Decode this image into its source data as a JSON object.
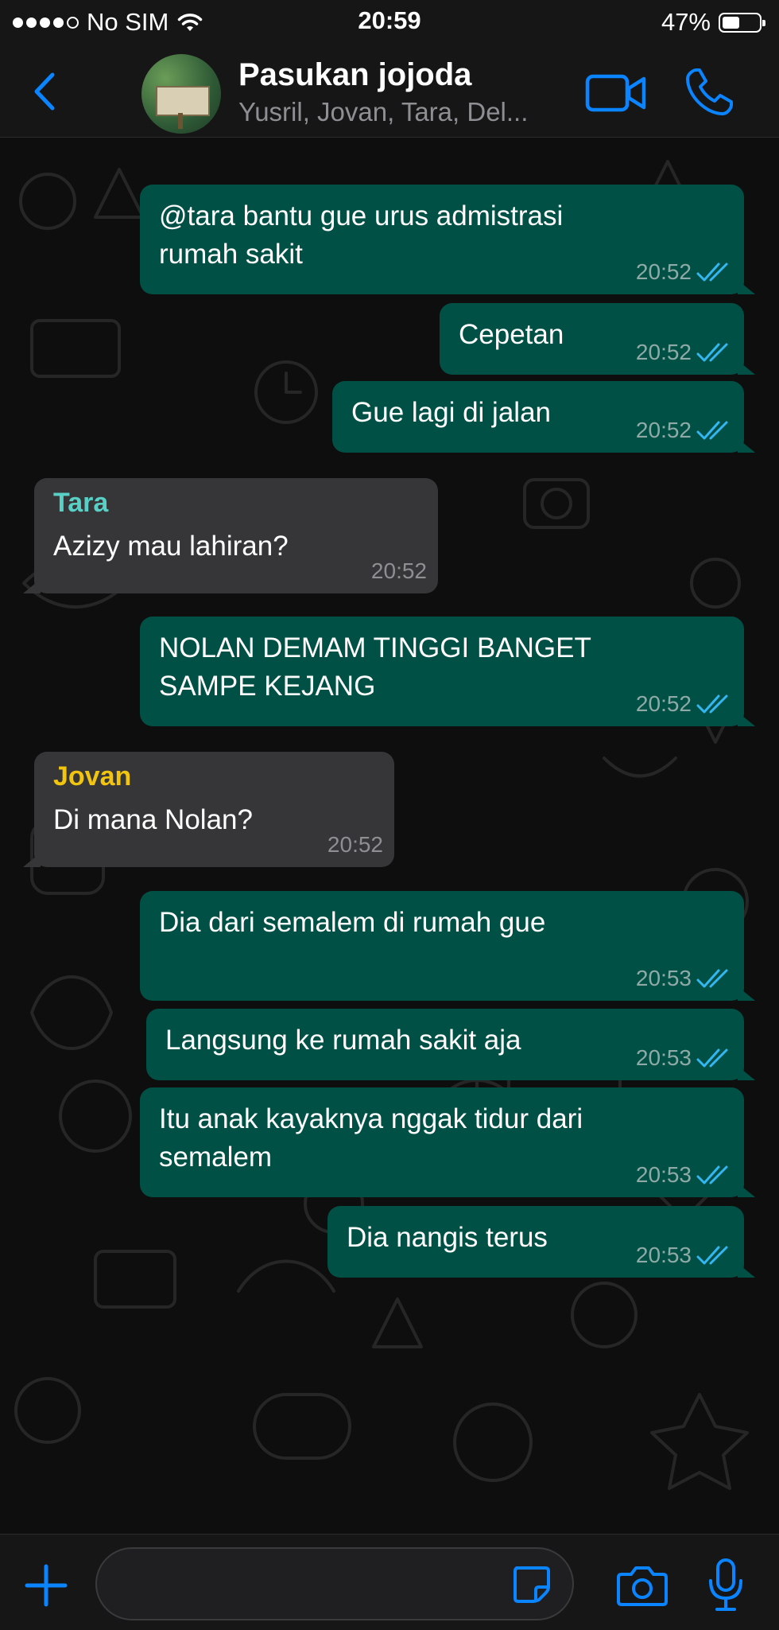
{
  "status_bar": {
    "carrier": "No SIM",
    "time": "20:59",
    "battery": "47%",
    "battery_level": 0.47,
    "signal_dots": 5,
    "signal_filled": 4
  },
  "header": {
    "back_icon": "chevron-left-icon",
    "title": "Pasukan jojoda",
    "subtitle": "Yusril, Jovan, Tara, Del...",
    "video_icon": "video-camera-icon",
    "call_icon": "phone-icon"
  },
  "colors": {
    "accent": "#0a84ff",
    "outgoing_bubble": "#005046",
    "incoming_bubble": "#363638",
    "read_ticks": "#34b7f1",
    "sender_tara": "#58d0c6",
    "sender_jovan": "#f1c40f"
  },
  "messages": [
    {
      "dir": "out",
      "lines": [
        "@tara bantu gue urus admistrasi",
        "rumah sakit"
      ],
      "time": "20:52",
      "read": true
    },
    {
      "dir": "out",
      "lines": [
        "Cepetan"
      ],
      "time": "20:52",
      "read": true
    },
    {
      "dir": "out",
      "lines": [
        "Gue lagi di jalan"
      ],
      "time": "20:52",
      "read": true
    },
    {
      "dir": "in",
      "sender": "Tara",
      "lines": [
        "Azizy mau lahiran?"
      ],
      "time": "20:52"
    },
    {
      "dir": "out",
      "lines": [
        "NOLAN DEMAM TINGGI BANGET",
        "SAMPE KEJANG"
      ],
      "time": "20:52",
      "read": true
    },
    {
      "dir": "in",
      "sender": "Jovan",
      "lines": [
        "Di mana Nolan?"
      ],
      "time": "20:52"
    },
    {
      "dir": "out",
      "lines": [
        "Dia dari semalem di rumah gue"
      ],
      "time": "20:53",
      "read": true
    },
    {
      "dir": "out",
      "lines": [
        "Langsung ke rumah sakit aja"
      ],
      "time": "20:53",
      "read": true
    },
    {
      "dir": "out",
      "lines": [
        "Itu anak kayaknya nggak tidur dari",
        "semalem"
      ],
      "time": "20:53",
      "read": true
    },
    {
      "dir": "out",
      "lines": [
        "Dia nangis terus"
      ],
      "time": "20:53",
      "read": true
    }
  ],
  "composer": {
    "plus_icon": "plus-icon",
    "input_value": "",
    "sticker_icon": "sticker-icon",
    "camera_icon": "camera-icon",
    "mic_icon": "microphone-icon"
  }
}
